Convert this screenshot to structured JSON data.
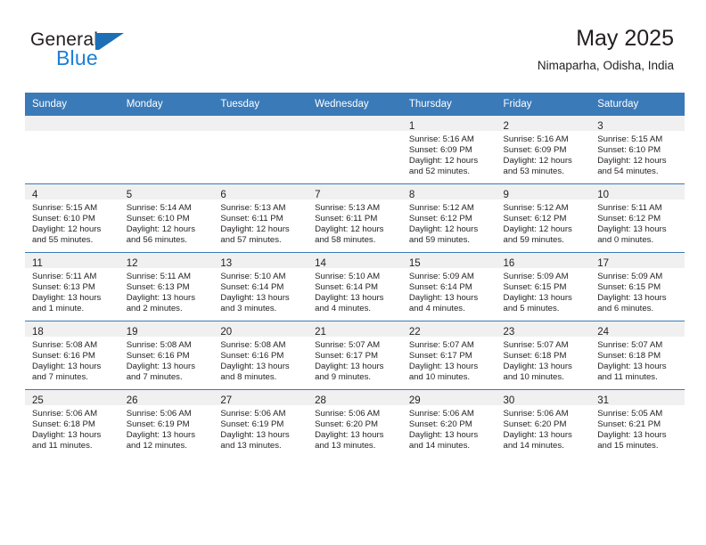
{
  "brand": {
    "name_dark": "General",
    "name_blue": "Blue",
    "mark": "triangle-flag-icon",
    "colors": {
      "blue": "#1c7fd6",
      "mark_blue": "#1c6fb5",
      "dark": "#231f20"
    }
  },
  "header": {
    "title": "May 2025",
    "subtitle": "Nimaparha, Odisha, India"
  },
  "colors": {
    "header_blue": "#3a7ab8",
    "daynum_band": "#f0f0f0",
    "text": "#231f20",
    "page_background": "#ffffff"
  },
  "weekday_headers": [
    "Sunday",
    "Monday",
    "Tuesday",
    "Wednesday",
    "Thursday",
    "Friday",
    "Saturday"
  ],
  "weeks": [
    [
      {
        "day": "",
        "sunrise": "",
        "sunset": "",
        "daylight1": "",
        "daylight2": ""
      },
      {
        "day": "",
        "sunrise": "",
        "sunset": "",
        "daylight1": "",
        "daylight2": ""
      },
      {
        "day": "",
        "sunrise": "",
        "sunset": "",
        "daylight1": "",
        "daylight2": ""
      },
      {
        "day": "",
        "sunrise": "",
        "sunset": "",
        "daylight1": "",
        "daylight2": ""
      },
      {
        "day": "1",
        "sunrise": "Sunrise: 5:16 AM",
        "sunset": "Sunset: 6:09 PM",
        "daylight1": "Daylight: 12 hours",
        "daylight2": "and 52 minutes."
      },
      {
        "day": "2",
        "sunrise": "Sunrise: 5:16 AM",
        "sunset": "Sunset: 6:09 PM",
        "daylight1": "Daylight: 12 hours",
        "daylight2": "and 53 minutes."
      },
      {
        "day": "3",
        "sunrise": "Sunrise: 5:15 AM",
        "sunset": "Sunset: 6:10 PM",
        "daylight1": "Daylight: 12 hours",
        "daylight2": "and 54 minutes."
      }
    ],
    [
      {
        "day": "4",
        "sunrise": "Sunrise: 5:15 AM",
        "sunset": "Sunset: 6:10 PM",
        "daylight1": "Daylight: 12 hours",
        "daylight2": "and 55 minutes."
      },
      {
        "day": "5",
        "sunrise": "Sunrise: 5:14 AM",
        "sunset": "Sunset: 6:10 PM",
        "daylight1": "Daylight: 12 hours",
        "daylight2": "and 56 minutes."
      },
      {
        "day": "6",
        "sunrise": "Sunrise: 5:13 AM",
        "sunset": "Sunset: 6:11 PM",
        "daylight1": "Daylight: 12 hours",
        "daylight2": "and 57 minutes."
      },
      {
        "day": "7",
        "sunrise": "Sunrise: 5:13 AM",
        "sunset": "Sunset: 6:11 PM",
        "daylight1": "Daylight: 12 hours",
        "daylight2": "and 58 minutes."
      },
      {
        "day": "8",
        "sunrise": "Sunrise: 5:12 AM",
        "sunset": "Sunset: 6:12 PM",
        "daylight1": "Daylight: 12 hours",
        "daylight2": "and 59 minutes."
      },
      {
        "day": "9",
        "sunrise": "Sunrise: 5:12 AM",
        "sunset": "Sunset: 6:12 PM",
        "daylight1": "Daylight: 12 hours",
        "daylight2": "and 59 minutes."
      },
      {
        "day": "10",
        "sunrise": "Sunrise: 5:11 AM",
        "sunset": "Sunset: 6:12 PM",
        "daylight1": "Daylight: 13 hours",
        "daylight2": "and 0 minutes."
      }
    ],
    [
      {
        "day": "11",
        "sunrise": "Sunrise: 5:11 AM",
        "sunset": "Sunset: 6:13 PM",
        "daylight1": "Daylight: 13 hours",
        "daylight2": "and 1 minute."
      },
      {
        "day": "12",
        "sunrise": "Sunrise: 5:11 AM",
        "sunset": "Sunset: 6:13 PM",
        "daylight1": "Daylight: 13 hours",
        "daylight2": "and 2 minutes."
      },
      {
        "day": "13",
        "sunrise": "Sunrise: 5:10 AM",
        "sunset": "Sunset: 6:14 PM",
        "daylight1": "Daylight: 13 hours",
        "daylight2": "and 3 minutes."
      },
      {
        "day": "14",
        "sunrise": "Sunrise: 5:10 AM",
        "sunset": "Sunset: 6:14 PM",
        "daylight1": "Daylight: 13 hours",
        "daylight2": "and 4 minutes."
      },
      {
        "day": "15",
        "sunrise": "Sunrise: 5:09 AM",
        "sunset": "Sunset: 6:14 PM",
        "daylight1": "Daylight: 13 hours",
        "daylight2": "and 4 minutes."
      },
      {
        "day": "16",
        "sunrise": "Sunrise: 5:09 AM",
        "sunset": "Sunset: 6:15 PM",
        "daylight1": "Daylight: 13 hours",
        "daylight2": "and 5 minutes."
      },
      {
        "day": "17",
        "sunrise": "Sunrise: 5:09 AM",
        "sunset": "Sunset: 6:15 PM",
        "daylight1": "Daylight: 13 hours",
        "daylight2": "and 6 minutes."
      }
    ],
    [
      {
        "day": "18",
        "sunrise": "Sunrise: 5:08 AM",
        "sunset": "Sunset: 6:16 PM",
        "daylight1": "Daylight: 13 hours",
        "daylight2": "and 7 minutes."
      },
      {
        "day": "19",
        "sunrise": "Sunrise: 5:08 AM",
        "sunset": "Sunset: 6:16 PM",
        "daylight1": "Daylight: 13 hours",
        "daylight2": "and 7 minutes."
      },
      {
        "day": "20",
        "sunrise": "Sunrise: 5:08 AM",
        "sunset": "Sunset: 6:16 PM",
        "daylight1": "Daylight: 13 hours",
        "daylight2": "and 8 minutes."
      },
      {
        "day": "21",
        "sunrise": "Sunrise: 5:07 AM",
        "sunset": "Sunset: 6:17 PM",
        "daylight1": "Daylight: 13 hours",
        "daylight2": "and 9 minutes."
      },
      {
        "day": "22",
        "sunrise": "Sunrise: 5:07 AM",
        "sunset": "Sunset: 6:17 PM",
        "daylight1": "Daylight: 13 hours",
        "daylight2": "and 10 minutes."
      },
      {
        "day": "23",
        "sunrise": "Sunrise: 5:07 AM",
        "sunset": "Sunset: 6:18 PM",
        "daylight1": "Daylight: 13 hours",
        "daylight2": "and 10 minutes."
      },
      {
        "day": "24",
        "sunrise": "Sunrise: 5:07 AM",
        "sunset": "Sunset: 6:18 PM",
        "daylight1": "Daylight: 13 hours",
        "daylight2": "and 11 minutes."
      }
    ],
    [
      {
        "day": "25",
        "sunrise": "Sunrise: 5:06 AM",
        "sunset": "Sunset: 6:18 PM",
        "daylight1": "Daylight: 13 hours",
        "daylight2": "and 11 minutes."
      },
      {
        "day": "26",
        "sunrise": "Sunrise: 5:06 AM",
        "sunset": "Sunset: 6:19 PM",
        "daylight1": "Daylight: 13 hours",
        "daylight2": "and 12 minutes."
      },
      {
        "day": "27",
        "sunrise": "Sunrise: 5:06 AM",
        "sunset": "Sunset: 6:19 PM",
        "daylight1": "Daylight: 13 hours",
        "daylight2": "and 13 minutes."
      },
      {
        "day": "28",
        "sunrise": "Sunrise: 5:06 AM",
        "sunset": "Sunset: 6:20 PM",
        "daylight1": "Daylight: 13 hours",
        "daylight2": "and 13 minutes."
      },
      {
        "day": "29",
        "sunrise": "Sunrise: 5:06 AM",
        "sunset": "Sunset: 6:20 PM",
        "daylight1": "Daylight: 13 hours",
        "daylight2": "and 14 minutes."
      },
      {
        "day": "30",
        "sunrise": "Sunrise: 5:06 AM",
        "sunset": "Sunset: 6:20 PM",
        "daylight1": "Daylight: 13 hours",
        "daylight2": "and 14 minutes."
      },
      {
        "day": "31",
        "sunrise": "Sunrise: 5:05 AM",
        "sunset": "Sunset: 6:21 PM",
        "daylight1": "Daylight: 13 hours",
        "daylight2": "and 15 minutes."
      }
    ]
  ]
}
